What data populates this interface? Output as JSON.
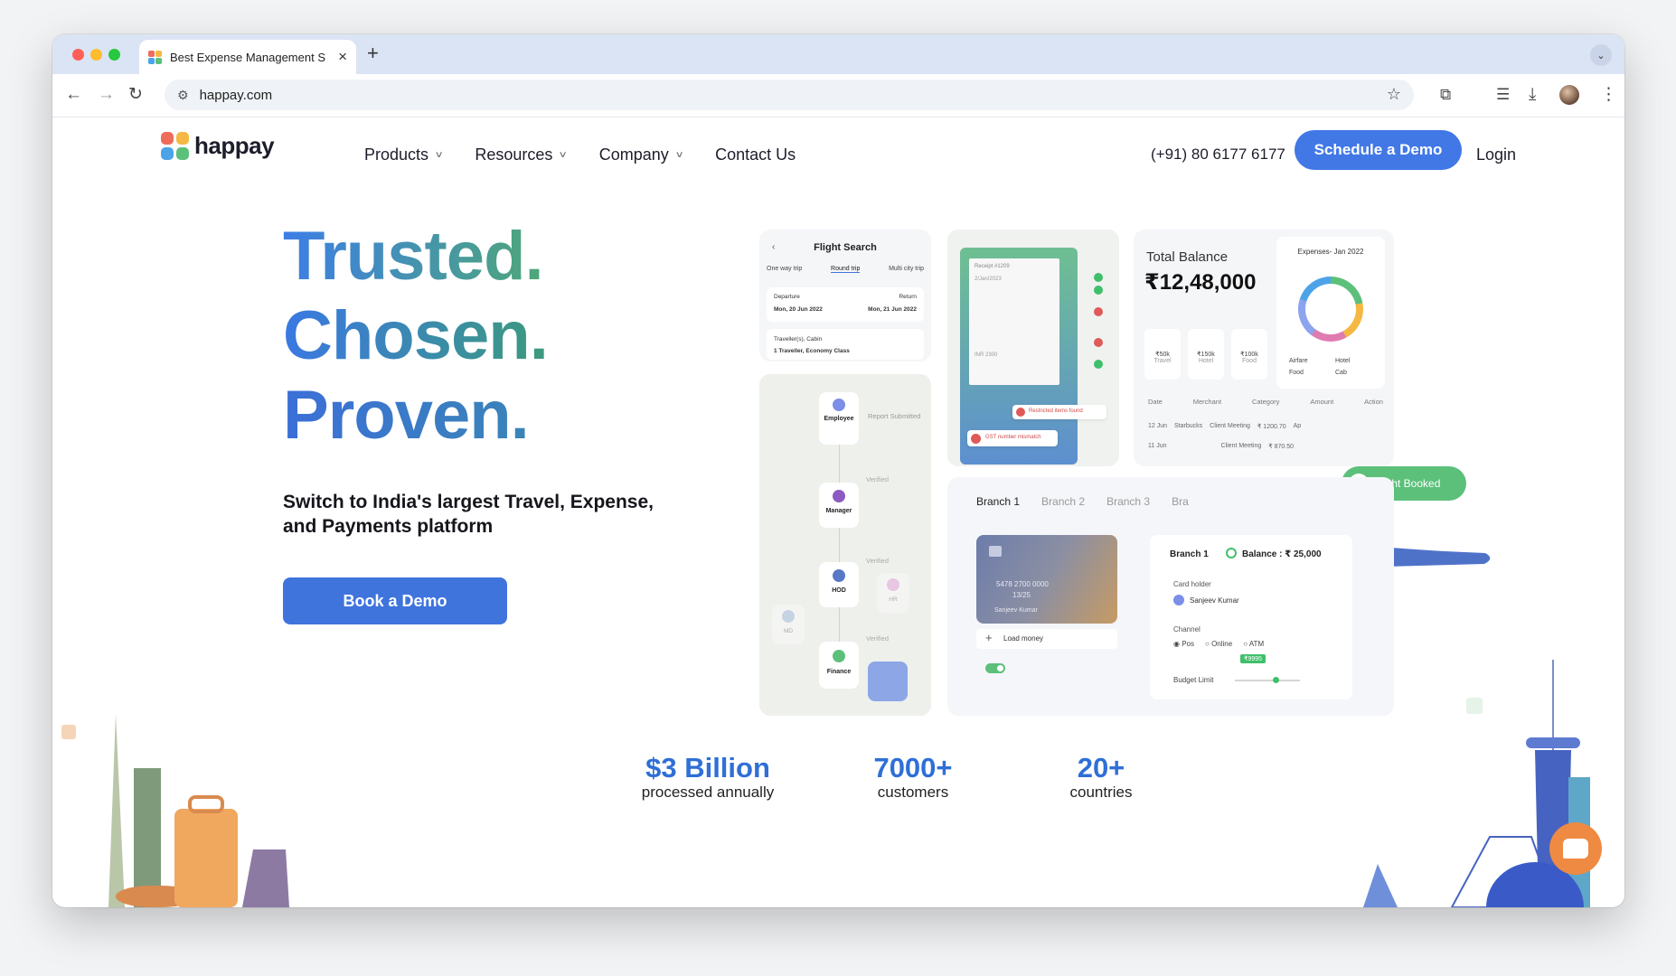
{
  "browser": {
    "tab_title": "Best Expense Management S",
    "url": "happay.com"
  },
  "site": {
    "logo_text": "happay",
    "nav": [
      {
        "label": "Products"
      },
      {
        "label": "Resources"
      },
      {
        "label": "Company"
      },
      {
        "label": "Contact Us"
      }
    ],
    "phone": "(+91) 80 6177 6177",
    "schedule_demo": "Schedule a Demo",
    "login": "Login"
  },
  "hero": {
    "line1": "Trusted.",
    "line2": "Chosen.",
    "line3": "Proven.",
    "subtitle": "Switch to India's largest Travel, Expense, and Payments platform",
    "book_demo": "Book a Demo"
  },
  "flight_card": {
    "title": "Flight Search",
    "trip_types": [
      "One way trip",
      "Round trip",
      "Multi city trip"
    ],
    "departure_label": "Departure",
    "departure_date": "Mon, 20 Jun 2022",
    "return_label": "Return",
    "return_date": "Mon, 21 Jun 2022",
    "traveller_label": "Traveller(s), Cabin",
    "traveller_value": "1 Traveller, Economy Class"
  },
  "approval_card": {
    "steps": [
      "Employee",
      "Manager",
      "HOD",
      "Finance"
    ],
    "side_steps": [
      "MD",
      "HR"
    ],
    "report_text": "Report Submitted",
    "verified": "Verified"
  },
  "receipt_card": {
    "receipt_no": "Receipt #1209",
    "date": "2/Jan/2023",
    "amount": "INR 2300",
    "alert1": "Restricted items found",
    "alert2": "GST number mismatch"
  },
  "balance_card": {
    "title": "Total Balance",
    "amount": "₹12,48,000",
    "chart_title": "Expenses- Jan 2022",
    "categories": [
      {
        "value": "₹50k",
        "label": "Travel"
      },
      {
        "value": "₹150k",
        "label": "Hotel"
      },
      {
        "value": "₹100k",
        "label": "Food"
      }
    ],
    "legend": [
      "Airfare",
      "Hotel",
      "Food",
      "Cab"
    ],
    "table_headers": [
      "Date",
      "Merchant",
      "Category",
      "Amount",
      "Action"
    ],
    "rows": [
      {
        "date": "12 Jun",
        "merchant": "Starbucks",
        "category": "Client Meeting",
        "amount": "₹ 1200.70",
        "action": "Ap"
      },
      {
        "date": "11 Jun",
        "merchant": "",
        "category": "Client Meeting",
        "amount": "₹ 870.50",
        "action": ""
      }
    ],
    "flight_booked": "Flight Booked"
  },
  "branch_card": {
    "tabs": [
      "Branch 1",
      "Branch 2",
      "Branch 3",
      "Bra"
    ],
    "card_number": "5478  2700  0000",
    "card_expiry": "13/25",
    "card_holder_on_card": "Sanjeev Kumar",
    "load_money": "Load money",
    "branch_title": "Branch 1",
    "balance_text": "Balance : ₹ 25,000",
    "card_holder_label": "Card holder",
    "card_holder": "Sanjeev Kumar",
    "channel_label": "Channel",
    "channels": [
      "Pos",
      "Online",
      "ATM"
    ],
    "budget_label": "Budget Limit",
    "budget_value": "₹9995"
  },
  "stats": [
    {
      "value": "$3 Billion",
      "label": "processed annually"
    },
    {
      "value": "7000+",
      "label": "customers"
    },
    {
      "value": "20+",
      "label": "countries"
    }
  ],
  "colors": {
    "brand_blue": "#4178e6",
    "gradient_green": "#4fa876",
    "chat_orange": "#ef8a43",
    "success_green": "#3fbf6a"
  }
}
